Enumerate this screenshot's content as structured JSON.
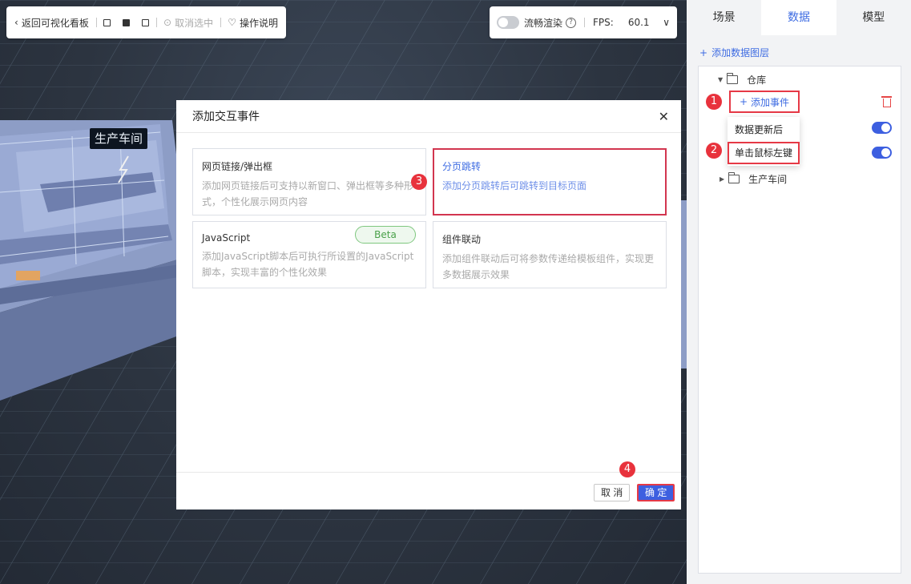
{
  "scene": {
    "building_label": "生产车间"
  },
  "toolbar": {
    "back_label": "返回可视化看板",
    "deselect_label": "取消选中",
    "guide_label": "操作说明"
  },
  "render": {
    "smooth_label": "流畅渲染",
    "fps_label": "FPS:",
    "fps_value": "60.1"
  },
  "panel": {
    "tabs": [
      {
        "label": "场景",
        "active": false
      },
      {
        "label": "数据",
        "active": true
      },
      {
        "label": "模型",
        "active": false
      }
    ],
    "add_layer": "添加数据图层",
    "tree": {
      "folder1": "仓库",
      "add_event": "添加事件",
      "dropdown": [
        "数据更新后",
        "单击鼠标左键"
      ],
      "folder2": "生产车间"
    }
  },
  "modal": {
    "title": "添加交互事件",
    "cards": [
      {
        "title": "网页链接/弹出框",
        "desc": "添加网页链接后可支持以新窗口、弹出框等多种形式，个性化展示网页内容"
      },
      {
        "title": "分页跳转",
        "desc": "添加分页跳转后可跳转到目标页面"
      },
      {
        "title": "JavaScript",
        "desc": "添加JavaScript脚本后可执行所设置的JavaScript脚本，实现丰富的个性化效果",
        "badge": "Beta"
      },
      {
        "title": "组件联动",
        "desc": "添加组件联动后可将参数传递给模板组件，实现更多数据展示效果"
      }
    ],
    "cancel": "取 消",
    "ok": "确 定"
  },
  "annotations": [
    "1",
    "2",
    "3",
    "4"
  ],
  "colors": {
    "accent": "#3d6be2",
    "highlight": "#e63946",
    "switch": "#3d5fe0"
  }
}
